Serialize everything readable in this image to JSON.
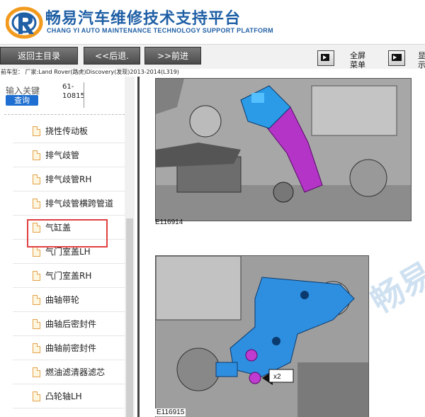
{
  "header": {
    "title": "畅易汽车维修技术支持平台",
    "subtitle": "CHANG YI AUTO MAINTENANCE TECHNOLOGY SUPPORT PLATFORM"
  },
  "toolbar": {
    "home_label": "返回主目录",
    "back_label": "<<后退.",
    "forward_label": ">>前进",
    "fullscreen_label_1": "全屏",
    "fullscreen_label_2": "菜单",
    "cutoff_label_1": "显",
    "cutoff_label_2": "示"
  },
  "breadcrumb": "前车型：  厂家:Land Rover(路虎)Discovery(发现)2013-2014(L319)",
  "sidebar": {
    "search_label": "输入关键",
    "search_code": "61-10815",
    "search_button": "查询",
    "items": [
      {
        "label": "挠性传动板"
      },
      {
        "label": "排气歧管"
      },
      {
        "label": "排气歧管RH"
      },
      {
        "label": "排气歧管横跨管道"
      },
      {
        "label": "气缸盖"
      },
      {
        "label": "气门室盖LH"
      },
      {
        "label": "气门室盖RH"
      },
      {
        "label": "曲轴带轮"
      },
      {
        "label": "曲轴后密封件"
      },
      {
        "label": "曲轴前密封件"
      },
      {
        "label": "燃油滤清器滤芯"
      },
      {
        "label": "凸轮轴LH"
      }
    ],
    "highlighted_index": 4
  },
  "content": {
    "figure_1_caption": "E116914",
    "figure_2_caption": "E116915",
    "figure_2_callout": "x2",
    "watermark": "畅易"
  },
  "colors": {
    "brand_blue": "#1f5fa5",
    "button_blue": "#1e6fd1",
    "highlight_red": "#e04040"
  }
}
